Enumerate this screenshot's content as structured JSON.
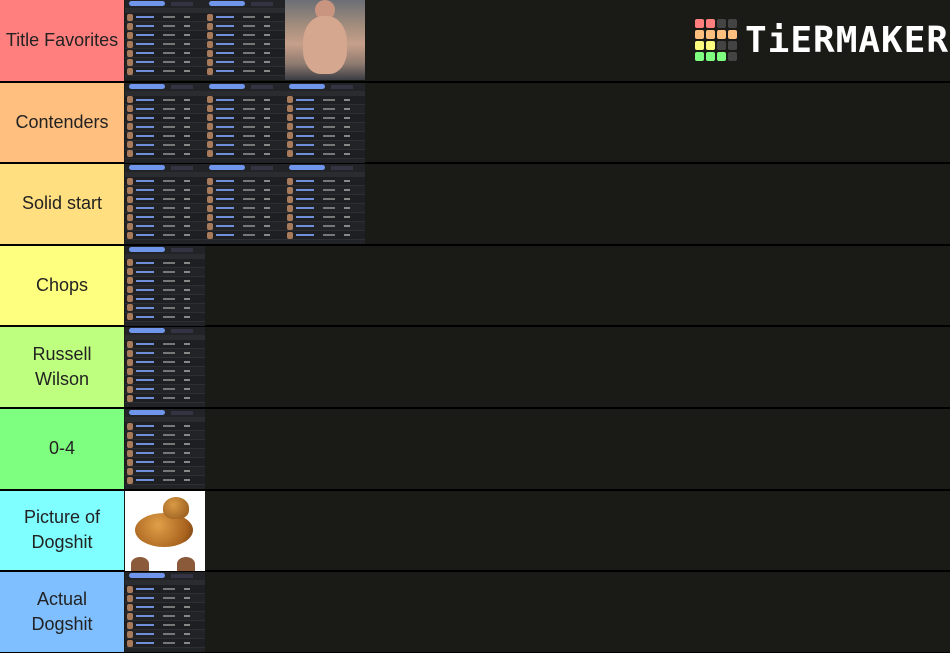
{
  "logo": {
    "text": "TiERMAKER",
    "grid_colors": [
      "#ff7f7f",
      "#ff7f7f",
      "#444",
      "#444",
      "#ffbf7f",
      "#ffbf7f",
      "#ffbf7f",
      "#ffbf7f",
      "#ffff7f",
      "#ffff7f",
      "#444",
      "#444",
      "#7fff7f",
      "#7fff7f",
      "#7fff7f",
      "#444"
    ]
  },
  "tiers": [
    {
      "label": "Title Favorites",
      "color": "#ff7f7f",
      "items": [
        "roster-screenshot",
        "roster-screenshot",
        "shirtless-man-photo"
      ]
    },
    {
      "label": "Contenders",
      "color": "#ffbf7f",
      "items": [
        "roster-screenshot",
        "roster-screenshot",
        "roster-screenshot"
      ]
    },
    {
      "label": "Solid start",
      "color": "#ffdf7f",
      "items": [
        "roster-screenshot",
        "roster-screenshot",
        "roster-screenshot"
      ]
    },
    {
      "label": "Chops",
      "color": "#ffff7f",
      "items": [
        "roster-screenshot"
      ]
    },
    {
      "label": "Russell Wilson",
      "color": "#bfff7f",
      "items": [
        "roster-screenshot"
      ]
    },
    {
      "label": "0-4",
      "color": "#7fff7f",
      "items": [
        "roster-screenshot"
      ]
    },
    {
      "label": "Picture of Dogshit",
      "color": "#7fffff",
      "items": [
        "dog-poop-photo"
      ]
    },
    {
      "label": "Actual Dogshit",
      "color": "#7fbfff",
      "items": [
        "roster-screenshot"
      ]
    }
  ]
}
